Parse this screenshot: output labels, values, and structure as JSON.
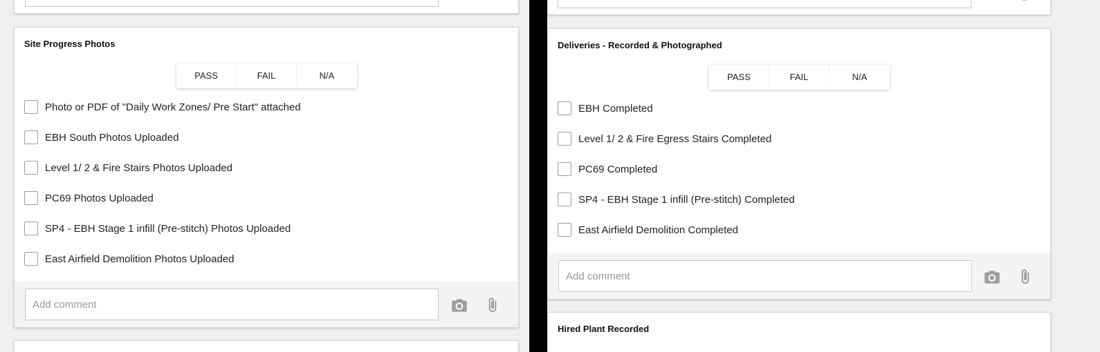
{
  "left": {
    "section": {
      "title": "Site Progress Photos",
      "options": [
        "PASS",
        "FAIL",
        "N/A"
      ],
      "items": [
        "Photo or PDF of \"Daily Work Zones/ Pre Start\" attached",
        "EBH South Photos Uploaded",
        "Level 1/ 2 & Fire Stairs Photos Uploaded",
        "PC69 Photos Uploaded",
        "SP4 - EBH Stage 1 infill (Pre-stitch) Photos Uploaded",
        "East Airfield Demolition Photos Uploaded"
      ],
      "comment_placeholder": "Add comment"
    }
  },
  "right": {
    "section": {
      "title": "Deliveries - Recorded & Photographed",
      "options": [
        "PASS",
        "FAIL",
        "N/A"
      ],
      "items": [
        "EBH Completed",
        "Level 1/ 2 & Fire Egress Stairs Completed",
        "PC69 Completed",
        "SP4 - EBH Stage 1 infill (Pre-stitch) Completed",
        "East Airfield Demolition Completed"
      ],
      "comment_placeholder": "Add comment"
    },
    "next_section": {
      "title": "Hired Plant Recorded"
    }
  },
  "icons": {
    "camera": "camera-icon",
    "attach": "paperclip-icon"
  },
  "colors": {
    "divider": "#000000",
    "icon_gray": "#9e9e9e",
    "comment_bar": "#f4f4f4"
  }
}
